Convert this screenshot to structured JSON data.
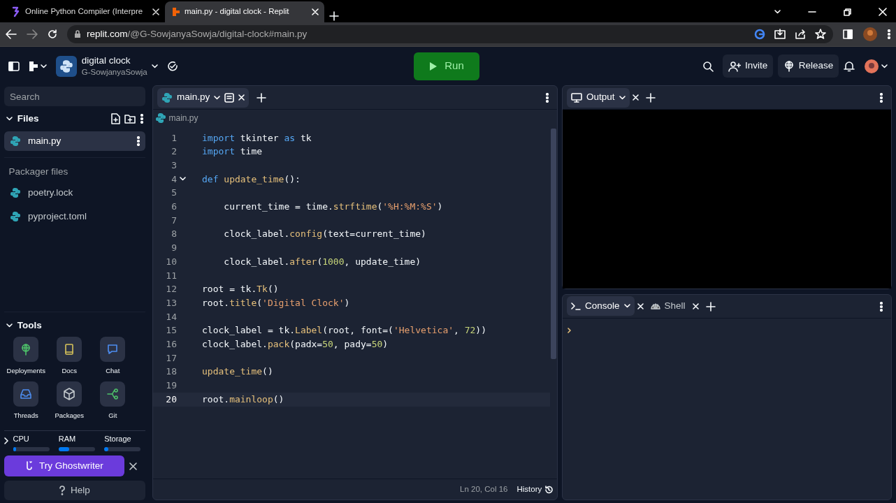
{
  "browser": {
    "tabs": [
      {
        "title": "Online Python Compiler (Interpre",
        "selected": false
      },
      {
        "title": "main.py - digital clock - Replit",
        "selected": true
      }
    ],
    "address": {
      "host": "replit.com",
      "path": "/@G-SowjanyaSowja/digital-clock#main.py"
    }
  },
  "header": {
    "project": {
      "name": "digital clock",
      "owner": "G-SowjanyaSowja"
    },
    "run_button": "Run",
    "invite_button": "Invite",
    "release_button": "Release"
  },
  "sidebar": {
    "search": {
      "placeholder": "Search"
    },
    "files_heading": "Files",
    "files": [
      {
        "name": "main.py",
        "selected": true
      }
    ],
    "packager_heading": "Packager files",
    "packager_files": [
      {
        "name": "poetry.lock",
        "selected": false
      },
      {
        "name": "pyproject.toml",
        "selected": false
      }
    ],
    "tools_heading": "Tools",
    "tools": [
      {
        "label": "Deployments",
        "kind": "deploy"
      },
      {
        "label": "Docs",
        "kind": "docs"
      },
      {
        "label": "Chat",
        "kind": "chat"
      },
      {
        "label": "Threads",
        "kind": "threads"
      },
      {
        "label": "Packages",
        "kind": "packages"
      },
      {
        "label": "Git",
        "kind": "git"
      }
    ],
    "resources": [
      {
        "label": "CPU",
        "level": 0.05
      },
      {
        "label": "RAM",
        "level": 0.3
      },
      {
        "label": "Storage",
        "level": 0.12
      }
    ],
    "ghostwriter_button": "Try Ghostwriter",
    "help_button": "Help"
  },
  "editor": {
    "tabs": [
      {
        "label": "main.py",
        "selected": true
      }
    ],
    "breadcrumb": "main.py",
    "lines": [
      {
        "number": "1",
        "current": false,
        "tokens": [
          {
            "text": "import",
            "kind": "keyword"
          },
          {
            "text": " tkinter ",
            "kind": "name"
          },
          {
            "text": "as",
            "kind": "keyword"
          },
          {
            "text": " tk",
            "kind": "name"
          }
        ]
      },
      {
        "number": "2",
        "current": false,
        "tokens": [
          {
            "text": "import",
            "kind": "keyword"
          },
          {
            "text": " time",
            "kind": "name"
          }
        ]
      },
      {
        "number": "3",
        "current": false
      },
      {
        "number": "4",
        "current": false,
        "fold": true,
        "tokens": [
          {
            "text": "def",
            "kind": "keyword"
          },
          {
            "text": " update_time",
            "kind": "function"
          },
          {
            "text": "():",
            "kind": "name"
          }
        ]
      },
      {
        "number": "5",
        "current": false
      },
      {
        "number": "6",
        "current": false,
        "tokens": [
          {
            "text": "    current_time = time.",
            "kind": "name"
          },
          {
            "text": "strftime",
            "kind": "function"
          },
          {
            "text": "(",
            "kind": "name"
          },
          {
            "text": "'%H:%M:%S'",
            "kind": "string"
          },
          {
            "text": ")",
            "kind": "name"
          }
        ]
      },
      {
        "number": "7",
        "current": false
      },
      {
        "number": "8",
        "current": false,
        "tokens": [
          {
            "text": "    clock_label.",
            "kind": "name"
          },
          {
            "text": "config",
            "kind": "function"
          },
          {
            "text": "(text=current_time)",
            "kind": "name"
          }
        ]
      },
      {
        "number": "9",
        "current": false
      },
      {
        "number": "10",
        "current": false,
        "tokens": [
          {
            "text": "    clock_label.",
            "kind": "name"
          },
          {
            "text": "after",
            "kind": "function"
          },
          {
            "text": "(",
            "kind": "name"
          },
          {
            "text": "1000",
            "kind": "number"
          },
          {
            "text": ", update_time)",
            "kind": "name"
          }
        ]
      },
      {
        "number": "11",
        "current": false
      },
      {
        "number": "12",
        "current": false,
        "tokens": [
          {
            "text": "root = tk.",
            "kind": "name"
          },
          {
            "text": "Tk",
            "kind": "function"
          },
          {
            "text": "()",
            "kind": "name"
          }
        ]
      },
      {
        "number": "13",
        "current": false,
        "tokens": [
          {
            "text": "root.",
            "kind": "name"
          },
          {
            "text": "title",
            "kind": "function"
          },
          {
            "text": "(",
            "kind": "name"
          },
          {
            "text": "'Digital Clock'",
            "kind": "string"
          },
          {
            "text": ")",
            "kind": "name"
          }
        ]
      },
      {
        "number": "14",
        "current": false
      },
      {
        "number": "15",
        "current": false,
        "tokens": [
          {
            "text": "clock_label = tk.",
            "kind": "name"
          },
          {
            "text": "Label",
            "kind": "function"
          },
          {
            "text": "(root, font=(",
            "kind": "name"
          },
          {
            "text": "'Helvetica'",
            "kind": "string"
          },
          {
            "text": ", ",
            "kind": "name"
          },
          {
            "text": "72",
            "kind": "number"
          },
          {
            "text": "))",
            "kind": "name"
          }
        ]
      },
      {
        "number": "16",
        "current": false,
        "tokens": [
          {
            "text": "clock_label.",
            "kind": "name"
          },
          {
            "text": "pack",
            "kind": "function"
          },
          {
            "text": "(padx=",
            "kind": "name"
          },
          {
            "text": "50",
            "kind": "number"
          },
          {
            "text": ", pady=",
            "kind": "name"
          },
          {
            "text": "50",
            "kind": "number"
          },
          {
            "text": ")",
            "kind": "name"
          }
        ]
      },
      {
        "number": "17",
        "current": false
      },
      {
        "number": "18",
        "current": false,
        "tokens": [
          {
            "text": "update_time",
            "kind": "function"
          },
          {
            "text": "()",
            "kind": "name"
          }
        ]
      },
      {
        "number": "19",
        "current": false
      },
      {
        "number": "20",
        "current": true,
        "tokens": [
          {
            "text": "root.",
            "kind": "name"
          },
          {
            "text": "mainloop",
            "kind": "function"
          },
          {
            "text": "()",
            "kind": "name"
          }
        ]
      }
    ],
    "status": {
      "position": "Ln 20, Col 16",
      "history": "History"
    }
  },
  "output": {
    "tabs": [
      {
        "label": "Output",
        "selected": true
      }
    ]
  },
  "console": {
    "tabs": [
      {
        "label": "Console",
        "selected": true,
        "kind": "console"
      },
      {
        "label": "Shell",
        "selected": false,
        "kind": "shell"
      }
    ]
  }
}
